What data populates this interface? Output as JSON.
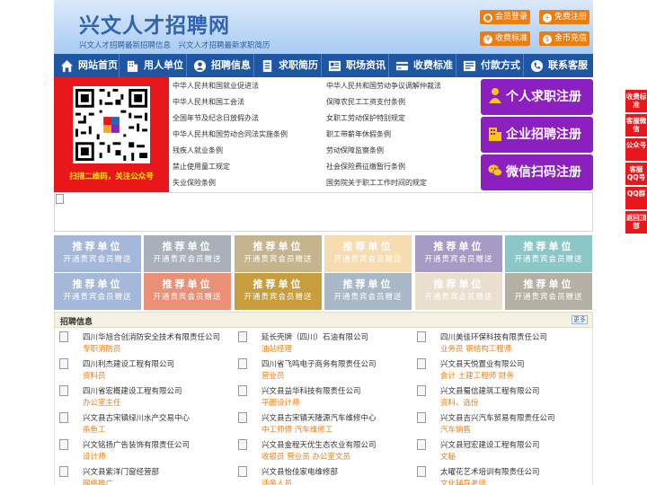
{
  "header": {
    "logo": "兴文人才招聘网",
    "slogan": "兴文人才招聘最新招聘信息　兴文人才招聘最新求职简历",
    "buttons": [
      {
        "label": "会员登录",
        "icon": "user-icon"
      },
      {
        "label": "免费注册",
        "icon": "register-icon"
      },
      {
        "label": "收费标准",
        "icon": "price-icon"
      },
      {
        "label": "金币充值",
        "icon": "coin-icon"
      }
    ]
  },
  "nav": [
    {
      "label": "网站首页",
      "icon": "home-icon"
    },
    {
      "label": "用人单位",
      "icon": "building-icon"
    },
    {
      "label": "招聘信息",
      "icon": "recruit-icon"
    },
    {
      "label": "求职简历",
      "icon": "resume-icon"
    },
    {
      "label": "职场资讯",
      "icon": "news-icon"
    },
    {
      "label": "收费标准",
      "icon": "price-icon"
    },
    {
      "label": "付款方式",
      "icon": "payment-icon"
    },
    {
      "label": "联系客服",
      "icon": "phone-icon"
    }
  ],
  "qr": {
    "caption": "扫描二维码，关注公众号"
  },
  "laws": [
    "中华人民共和国就业促进法",
    "中华人民共和国劳动争议调解仲裁法",
    "中华人民共和国工会法",
    "保障农民工工资支付条例",
    "全国年节及纪念日放假办法",
    "女职工劳动保护特别规定",
    "中华人民共和国劳动合同法实施条例",
    "职工带薪年休假条例",
    "残疾人就业条例",
    "劳动保障监察条例",
    "禁止使用童工规定",
    "社会保险费征缴暂行条例",
    "失业保险条例",
    "国务院关于职工工作时间的规定"
  ],
  "register": [
    {
      "label": "个人求职注册",
      "icon": "person-icon"
    },
    {
      "label": "企业招聘注册",
      "icon": "company-icon"
    },
    {
      "label": "微信扫码注册",
      "icon": "wechat-icon"
    }
  ],
  "recommend": {
    "title": "推荐单位",
    "subtitle": "开通贵宾会员赠送",
    "colors": [
      "#a6b8da",
      "#a9b0ba",
      "#c5b48e",
      "#f6dcb0",
      "#a79bc6",
      "#8cc6c6",
      "#a6b8da",
      "#ea9077",
      "#c79d3d",
      "#a9b8c6",
      "#eadfcf",
      "#b5b0a3"
    ]
  },
  "jobs_section": {
    "title": "招聘信息",
    "more": "更多"
  },
  "jobs": [
    {
      "company": "四川华旭合创消防安全技术有限责任公司",
      "positions": "专职消防员"
    },
    {
      "company": "延长壳牌（四川）石油有限公司",
      "positions": "油站经理"
    },
    {
      "company": "四川美佳环保科技有限责任公司",
      "positions": "业务员 钢结构工程师"
    },
    {
      "company": "四川利杰建设工程有限公司",
      "positions": "资料员"
    },
    {
      "company": "四川省飞鸣电子商务有限责任公司",
      "positions": "营业员"
    },
    {
      "company": "兴文县天悦置业有限公司",
      "positions": "会计 土建工程师 财务"
    },
    {
      "company": "四川省宏概建设工程有限公司",
      "positions": "办公室主任"
    },
    {
      "company": "兴文县益华科技有限责任公司",
      "positions": "平面设计师"
    },
    {
      "company": "兴文县蜀信建筑工程有限公司",
      "positions": "资料、选份"
    },
    {
      "company": "兴文县古宋镇绿川水产交易中心",
      "positions": "杀鱼工"
    },
    {
      "company": "兴文县古宋镇天隆源汽车维修中心",
      "positions": "中工师傅 汽车维修工"
    },
    {
      "company": "兴文县吉兴汽车贸易有限责任公司",
      "positions": "汽车销售"
    },
    {
      "company": "兴文铭扬广告装饰有限责任公司",
      "positions": "设计师"
    },
    {
      "company": "兴文县金程天优生态农业有限公司",
      "positions": "收银员 营业员 办公室文员"
    },
    {
      "company": "兴文县冠宏建设工程有限公司",
      "positions": "文秘"
    },
    {
      "company": "兴文县紫洋门窗经营部",
      "positions": "网络推广"
    },
    {
      "company": "兴文县怡佳家电维修部",
      "positions": "话务人员"
    },
    {
      "company": "太曜花艺术培训有限责任公司",
      "positions": "文化辅导老师"
    }
  ],
  "side": [
    {
      "label": "收费标准"
    },
    {
      "label": "客服微信"
    },
    {
      "label": "公众号"
    },
    {
      "label": "客服QQ号"
    },
    {
      "label": "QQ群"
    },
    {
      "label": "返回顶部"
    }
  ]
}
